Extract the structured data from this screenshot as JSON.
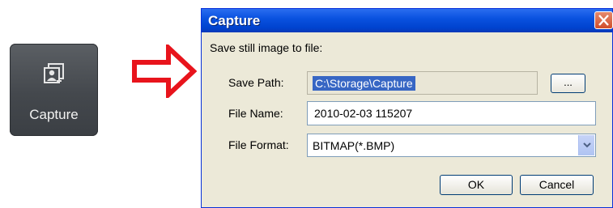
{
  "capture_tile": {
    "label": "Capture",
    "icon": "capture-icon",
    "colors": {
      "tile": "#44484d",
      "label": "#f2f2f2"
    }
  },
  "arrow": {
    "icon": "right-arrow-outline-icon",
    "color": "#e8141c"
  },
  "dialog": {
    "title": "Capture",
    "close_icon": "close-icon",
    "section_label": "Save still image to file:",
    "save_path_label": "Save Path:",
    "save_path_value": "C:\\Storage\\Capture",
    "browse_label": "...",
    "file_name_label": "File Name:",
    "file_name_value": "2010-02-03 115207",
    "file_format_label": "File Format:",
    "file_format_value": "BITMAP(*.BMP)",
    "ok_label": "OK",
    "cancel_label": "Cancel",
    "colors": {
      "titlebar": "#0a52e0",
      "body": "#ece9d8",
      "close": "#d14d2a",
      "selection": "#3766c4"
    }
  }
}
